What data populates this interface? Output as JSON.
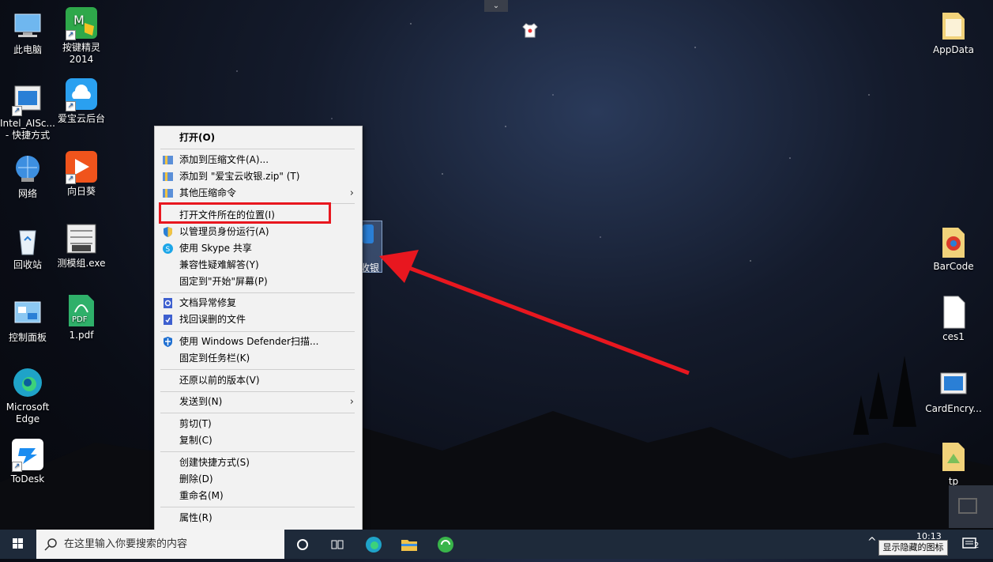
{
  "desktop": {
    "left_col1": [
      {
        "label": "此电脑",
        "icon": "computer-icon"
      },
      {
        "label": "Intel_AISc...\n- 快捷方式",
        "icon": "app-window-icon"
      },
      {
        "label": "网络",
        "icon": "network-globe-icon"
      },
      {
        "label": "回收站",
        "icon": "recycle-bin-icon"
      },
      {
        "label": "控制面板",
        "icon": "control-panel-icon"
      },
      {
        "label": "Microsoft\nEdge",
        "icon": "edge-icon"
      },
      {
        "label": "ToDesk",
        "icon": "todesk-icon"
      }
    ],
    "left_col2": [
      {
        "label": "按键精灵\n2014",
        "icon": "key-wizard-icon"
      },
      {
        "label": "爱宝云后台",
        "icon": "cloud-icon"
      },
      {
        "label": "向日葵",
        "icon": "sunflower-icon"
      },
      {
        "label": "测模组.exe",
        "icon": "exe-icon"
      },
      {
        "label": "1.pdf",
        "icon": "pdf-icon"
      }
    ],
    "right_col": [
      {
        "label": "AppData",
        "icon": "folder-icon"
      },
      {
        "label": "BarCode",
        "icon": "chrome-file-icon"
      },
      {
        "label": "ces1",
        "icon": "blank-file-icon"
      },
      {
        "label": "CardEncry...",
        "icon": "app-window-icon"
      },
      {
        "label": "tp",
        "icon": "folder-icon"
      }
    ],
    "selected_icon_label": "收银"
  },
  "context_menu": {
    "open": "打开(O)",
    "add_archive": "添加到压缩文件(A)...",
    "add_zip": "添加到 \"爱宝云收银.zip\" (T)",
    "other_compress": "其他压缩命令",
    "open_location": "打开文件所在的位置(I)",
    "run_admin": "以管理员身份运行(A)",
    "skype_share": "使用 Skype 共享",
    "compat": "兼容性疑难解答(Y)",
    "pin_start": "固定到\"开始\"屏幕(P)",
    "doc_repair": "文档异常修复",
    "recover_deleted": "找回误删的文件",
    "defender": "使用 Windows Defender扫描...",
    "pin_taskbar": "固定到任务栏(K)",
    "restore_prev": "还原以前的版本(V)",
    "send_to": "发送到(N)",
    "cut": "剪切(T)",
    "copy": "复制(C)",
    "create_shortcut": "创建快捷方式(S)",
    "delete": "删除(D)",
    "rename": "重命名(M)",
    "properties": "属性(R)"
  },
  "taskbar": {
    "search_placeholder": "在这里输入你要搜索的内容",
    "tray_tooltip": "显示隐藏的图标",
    "clock_time": "10:13",
    "notification_count": "2"
  },
  "colors": {
    "highlight_red": "#e8171f",
    "taskbar": "#1e2a3a",
    "menu_bg": "#f2f2f2"
  }
}
